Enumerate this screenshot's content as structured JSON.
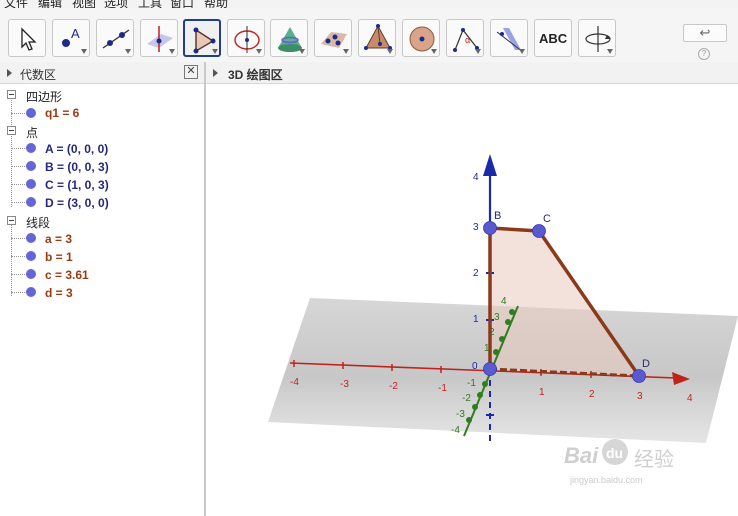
{
  "menu": [
    "文件",
    "编辑",
    "视图",
    "选项",
    "工具",
    "窗口",
    "帮助"
  ],
  "toolbar": {
    "tools": [
      {
        "name": "move-tool",
        "icon": "arrow-cursor-icon",
        "active": false
      },
      {
        "name": "point-tool",
        "icon": "point-icon",
        "active": false
      },
      {
        "name": "line-tool",
        "icon": "line-icon",
        "active": false
      },
      {
        "name": "perpendicular-line-tool",
        "icon": "perpendicular-line-icon",
        "active": false
      },
      {
        "name": "polygon-tool",
        "icon": "polygon-icon",
        "active": true
      },
      {
        "name": "circle-tool",
        "icon": "circle-icon",
        "active": false
      },
      {
        "name": "intersect-surfaces-tool",
        "icon": "intersect-surfaces-icon",
        "active": false
      },
      {
        "name": "plane-tool",
        "icon": "plane-icon",
        "active": false
      },
      {
        "name": "pyramid-tool",
        "icon": "pyramid-icon",
        "active": false
      },
      {
        "name": "sphere-tool",
        "icon": "sphere-icon",
        "active": false
      },
      {
        "name": "angle-tool",
        "icon": "angle-icon",
        "active": false
      },
      {
        "name": "reflect-tool",
        "icon": "reflect-icon",
        "active": false
      },
      {
        "name": "text-tool",
        "icon": "text-abc-icon",
        "label": "ABC",
        "active": false
      },
      {
        "name": "rotate-view-tool",
        "icon": "rotate-view-icon",
        "active": false
      }
    ],
    "undo_symbol": "↩",
    "help_symbol": "?"
  },
  "algebra_panel": {
    "title": "代数区",
    "close_symbol": "✕",
    "groups": [
      {
        "label": "四边形",
        "items": [
          {
            "text": "q1 = 6",
            "color": "#9a3a10"
          }
        ]
      },
      {
        "label": "点",
        "items": [
          {
            "text": "A = (0, 0, 0)",
            "color": "#28287a"
          },
          {
            "text": "B = (0, 0, 3)",
            "color": "#28287a"
          },
          {
            "text": "C = (1, 0, 3)",
            "color": "#28287a"
          },
          {
            "text": "D = (3, 0, 0)",
            "color": "#28287a"
          }
        ]
      },
      {
        "label": "线段",
        "items": [
          {
            "text": "a = 3",
            "color": "#9a3a10"
          },
          {
            "text": "b = 1",
            "color": "#9a3a10"
          },
          {
            "text": "c = 3.61",
            "color": "#9a3a10"
          },
          {
            "text": "d = 3",
            "color": "#9a3a10"
          }
        ]
      }
    ]
  },
  "graphics3d": {
    "title": "3D 绘图区",
    "x_axis_ticks": [
      "-4",
      "-3",
      "-2",
      "-1",
      "0",
      "1",
      "2",
      "3",
      "4"
    ],
    "y_axis_ticks": [
      "-4",
      "-3",
      "-2",
      "-1",
      "1",
      "2",
      "3",
      "4"
    ],
    "z_axis_ticks": [
      "1",
      "2",
      "3",
      "4"
    ],
    "origin_label": "0",
    "point_labels": [
      "B",
      "C",
      "D"
    ],
    "colors": {
      "x_axis": "#c0231c",
      "y_axis": "#2e7d1e",
      "z_axis": "#1a2aa8",
      "polygon_edge": "#8a3a1a",
      "point": "#5a5ad0"
    }
  },
  "watermark": {
    "brand": "Bai",
    "brand2": "du",
    "cn": "经验",
    "url": "jingyan.baidu.com"
  }
}
